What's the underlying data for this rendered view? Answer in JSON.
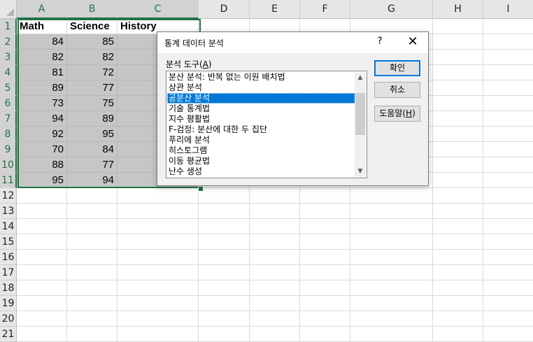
{
  "spreadsheet": {
    "columns": [
      "A",
      "B",
      "C",
      "D",
      "E",
      "F",
      "G",
      "H",
      "I"
    ],
    "rows": [
      "1",
      "2",
      "3",
      "4",
      "5",
      "6",
      "7",
      "8",
      "9",
      "10",
      "11",
      "12",
      "13",
      "14",
      "15",
      "16",
      "17",
      "18",
      "19",
      "20",
      "21"
    ],
    "headers": [
      "Math",
      "Science",
      "History"
    ],
    "data": [
      [
        84,
        85
      ],
      [
        82,
        82
      ],
      [
        81,
        72
      ],
      [
        89,
        77
      ],
      [
        73,
        75
      ],
      [
        94,
        89
      ],
      [
        92,
        95
      ],
      [
        70,
        84
      ],
      [
        88,
        77
      ],
      [
        95,
        94
      ]
    ],
    "selection_color": "#217346"
  },
  "dialog": {
    "title": "통계 데이터 분석",
    "help_symbol": "?",
    "close_symbol": "✕",
    "tools_label": "분석 도구(",
    "tools_label_key": "A",
    "tools_label_end": ")",
    "tools": [
      "분산 분석: 반복 없는 이원 배치법",
      "상관 분석",
      "공분산 분석",
      "기술 통계법",
      "지수 평활법",
      "F-검정: 분산에 대한 두 집단",
      "푸리에 분석",
      "히스토그램",
      "이동 평균법",
      "난수 생성"
    ],
    "selected_tool": "공분산 분석",
    "ok_label": "확인",
    "cancel_label": "취소",
    "help_label": "도움말(",
    "help_key": "H",
    "help_label_end": ")",
    "scroll_up": "▲",
    "scroll_down": "▼",
    "accent": "#0078d7"
  }
}
